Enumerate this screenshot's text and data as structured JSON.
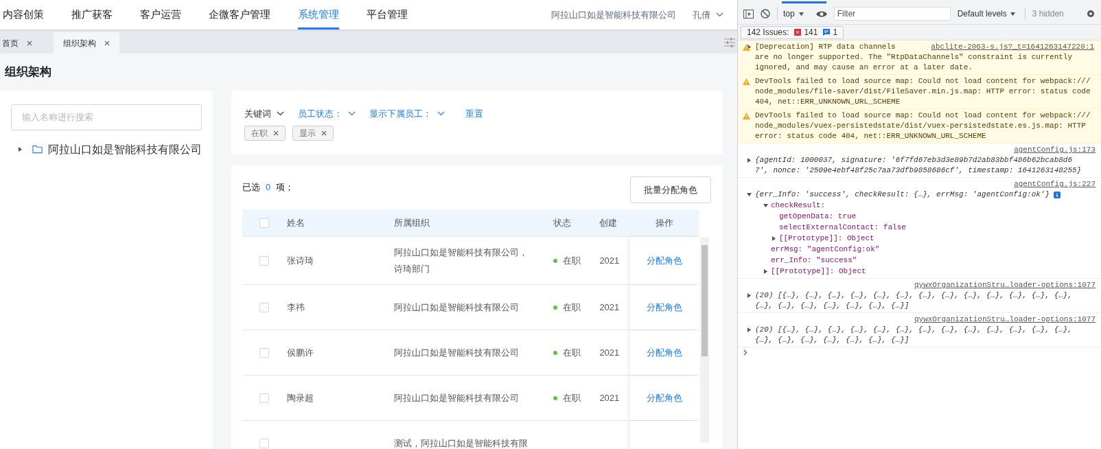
{
  "nav": {
    "items": [
      {
        "label": "内容创策",
        "selected": false
      },
      {
        "label": "推广获客",
        "selected": false
      },
      {
        "label": "客户运营",
        "selected": false
      },
      {
        "label": "企微客户管理",
        "selected": false
      },
      {
        "label": "系统管理",
        "selected": true
      },
      {
        "label": "平台管理",
        "selected": false
      }
    ],
    "company": "阿拉山口如是智能科技有限公司",
    "user": "孔倩"
  },
  "tabs": [
    {
      "label": "首页",
      "selected": false
    },
    {
      "label": "组织架构",
      "selected": true
    }
  ],
  "page_title": "组织架构",
  "tree": {
    "search_placeholder": "输入名称进行搜索",
    "nodes": [
      {
        "label": "阿拉山口如是智能科技有限公司",
        "expanded": false
      }
    ]
  },
  "filters": {
    "items": [
      {
        "label": "关键词",
        "kind": "plain"
      },
      {
        "label": "员工状态：",
        "kind": "active"
      },
      {
        "label": "显示下属员工：",
        "kind": "active"
      }
    ],
    "reset": "重置",
    "tags": [
      "在职",
      "显示"
    ]
  },
  "selection": {
    "prefix": "已选",
    "count": "0",
    "suffix": "项；"
  },
  "batch_button": "批量分配角色",
  "table": {
    "select_all_checked": false,
    "columns": [
      "姓名",
      "所属组织",
      "状态",
      "创建",
      "操作"
    ],
    "rows": [
      {
        "checked": false,
        "name": "张诗琦",
        "org": [
          "阿拉山口如是智能科技有限公司，",
          "诗琦部门"
        ],
        "status": "在职",
        "created": "2021",
        "action": "分配角色"
      },
      {
        "checked": false,
        "name": "李祎",
        "org": [
          "阿拉山口如是智能科技有限公司"
        ],
        "status": "在职",
        "created": "2021",
        "action": "分配角色"
      },
      {
        "checked": false,
        "name": "侯鹏许",
        "org": [
          "阿拉山口如是智能科技有限公司"
        ],
        "status": "在职",
        "created": "2021",
        "action": "分配角色"
      },
      {
        "checked": false,
        "name": "陶录超",
        "org": [
          "阿拉山口如是智能科技有限公司"
        ],
        "status": "在职",
        "created": "2021",
        "action": "分配角色"
      },
      {
        "checked": false,
        "org": [
          "测试，阿拉山口如是智能科技有限"
        ]
      }
    ]
  },
  "devtools": {
    "context": "top",
    "filter_placeholder": "Filter",
    "levels": "Default levels",
    "hidden": "3 hidden",
    "issues": {
      "label": "142 Issues:",
      "errors": "141",
      "info": "1"
    },
    "messages": [
      {
        "kind": "warning",
        "expanded": false,
        "source": "abclite-2063-s.js?_t=1641263147220:1",
        "lines": [
          "[Deprecation] RTP data channels",
          "are no longer supported. The \"RtpDataChannels\" constraint is currently",
          "ignored, and may cause an error at a later date."
        ]
      },
      {
        "kind": "warning",
        "lines": [
          "DevTools failed to load source map: Could not load content for webpack:///",
          "node_modules/file-saver/dist/FileSaver.min.js.map: HTTP error: status code",
          "404, net::ERR_UNKNOWN_URL_SCHEME"
        ]
      },
      {
        "kind": "warning",
        "lines": [
          "DevTools failed to load source map: Could not load content for webpack:///",
          "node_modules/vuex-persistedstate/dist/vuex-persistedstate.es.js.map: HTTP",
          "error: status code 404, net::ERR_UNKNOWN_URL_SCHEME"
        ]
      },
      {
        "kind": "object",
        "expanded": false,
        "source": "agentConfig.js:173",
        "lines": [
          "{agentId: 1000037, signature: '6f7fd67eb3d3e89b7d2ab83bbf486b62bcab8d6",
          "7', nonce: '2509e4ebf48f25c7aa73dfb9858686cf', timestamp: 1641263148255}"
        ]
      },
      {
        "kind": "object",
        "expanded": true,
        "source": "agentConfig.js:227",
        "lines": [
          "{err_Info: 'success', checkResult: {…}, errMsg: 'agentConfig:ok'}"
        ],
        "children": [
          {
            "text": "checkResult:",
            "expanded": true,
            "children": [
              {
                "text": "getOpenData: true"
              },
              {
                "text": "selectExternalContact: false"
              },
              {
                "text": "[[Prototype]]: Object",
                "expanded": false
              }
            ]
          },
          {
            "text": "errMsg: \"agentConfig:ok\""
          },
          {
            "text": "err_Info: \"success\""
          },
          {
            "text": "[[Prototype]]: Object",
            "expanded": false
          }
        ]
      },
      {
        "kind": "object",
        "expanded": false,
        "source": "qywxOrganizationStru…loader-options:1077",
        "lines": [
          "(20) [{…}, {…}, {…}, {…}, {…}, {…}, {…}, {…}, {…}, {…}, {…}, {…}, {…},",
          "{…}, {…}, {…}, {…}, {…}, {…}, {…}]"
        ]
      },
      {
        "kind": "object",
        "expanded": false,
        "source": "qywxOrganizationStru…loader-options:1077",
        "lines": [
          "(20) [{…}, {…}, {…}, {…}, {…}, {…}, {…}, {…}, {…}, {…}, {…}, {…}, {…},",
          "{…}, {…}, {…}, {…}, {…}, {…}, {…}]"
        ]
      }
    ]
  }
}
